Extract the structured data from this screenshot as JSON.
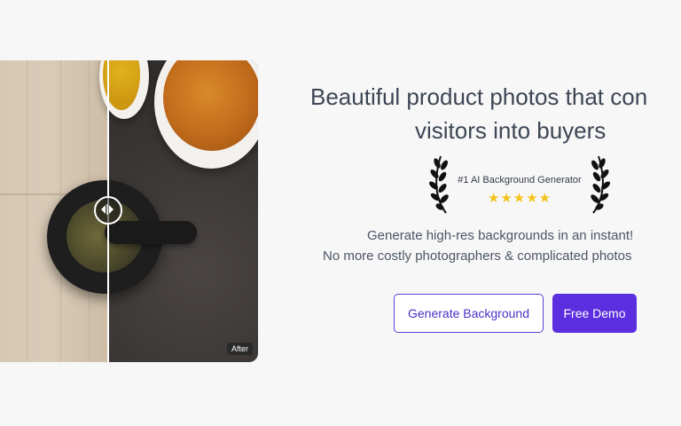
{
  "compare": {
    "after_label": "After",
    "slider_position": 0.42
  },
  "hero": {
    "headline_line1": "Beautiful product photos that con",
    "headline_line2": "visitors into buyers",
    "award_title": "#1 AI Background Generator",
    "stars": "★★★★★",
    "rating": 5,
    "sub_line1": "Generate high-res backgrounds in an instant!",
    "sub_line2": "No more costly photographers & complicated photos"
  },
  "buttons": {
    "generate_label": "Generate Background",
    "demo_label": "Free Demo"
  },
  "colors": {
    "accent": "#5b2ee0",
    "star": "#f3c419",
    "headline": "#3d4654"
  },
  "icons": [
    "compare-arrows-icon",
    "laurel-left-icon",
    "laurel-right-icon",
    "star-icon"
  ]
}
